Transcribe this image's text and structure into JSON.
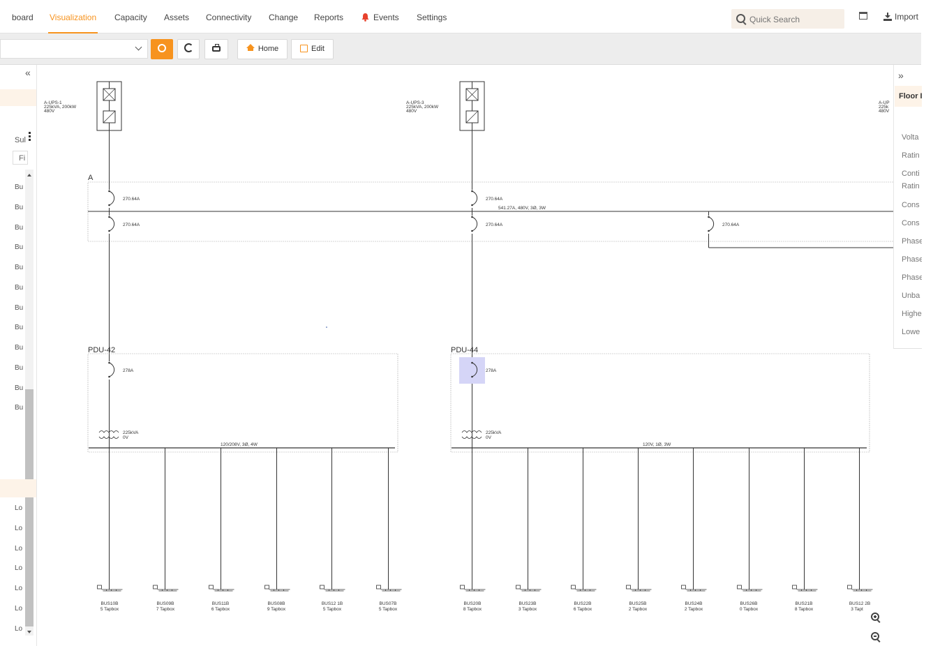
{
  "nav": {
    "items": [
      "board",
      "Visualization",
      "Capacity",
      "Assets",
      "Connectivity",
      "Change",
      "Reports",
      "Events",
      "Settings"
    ],
    "search_placeholder": "Quick Search",
    "import_label": "Import"
  },
  "toolbar": {
    "home_label": "Home",
    "edit_label": "Edit"
  },
  "left_panel": {
    "collapse": "«",
    "filter_label": "Sul",
    "filter_input": "Fi",
    "bus_rows": [
      "Bu",
      "Bu",
      "Bu",
      "Bu",
      "Bu",
      "Bu",
      "Bu",
      "Bu",
      "Bu",
      "Bu",
      "Bu",
      "Bu"
    ],
    "load_rows": [
      "Lo",
      "Lo",
      "Lo",
      "Lo",
      "Lo",
      "Lo",
      "Lo"
    ]
  },
  "right_panel": {
    "expand": "»",
    "title": "Floor I",
    "rows": [
      "Volta",
      "Ratin",
      "Conti",
      "Ratin",
      "Cons",
      "Cons",
      "Phase",
      "Phase",
      "Phase",
      "Unba",
      "Highe",
      "Lowe"
    ]
  },
  "diagram": {
    "ups": [
      {
        "name": "A-UPS-1",
        "rating": "225kVA, 200kW",
        "voltage": "480V"
      },
      {
        "name": "A-UPS-3",
        "rating": "225kVA, 200kW",
        "voltage": "480V"
      },
      {
        "name": "A-UP",
        "rating": "225k",
        "voltage": "480V"
      }
    ],
    "switchboard": {
      "name": "A",
      "bus_label": "541.27A, 480V, 3Ø, 3W",
      "breakers": [
        "270.64A",
        "270.64A",
        "270.64A",
        "270.64A",
        "270.64A"
      ]
    },
    "pdus": [
      {
        "name": "PDU-42",
        "breaker": "278A",
        "transformer": "225kVA",
        "transformer_v": "0V",
        "bus_label": "120/208V, 3Ø, 4W",
        "buses": [
          {
            "name": "BUS10B",
            "tap": "5 Tapbox"
          },
          {
            "name": "BUS09B",
            "tap": "7 Tapbox"
          },
          {
            "name": "BUS11B",
            "tap": "6 Tapbox"
          },
          {
            "name": "BUS08B",
            "tap": "9 Tapbox"
          },
          {
            "name": "BUS12 1B",
            "tap": "5 Tapbox"
          },
          {
            "name": "BUS07B",
            "tap": "5 Tapbox"
          }
        ]
      },
      {
        "name": "PDU-44",
        "breaker": "278A",
        "transformer": "225kVA",
        "transformer_v": "0V",
        "bus_label": "120V, 1Ø, 3W",
        "buses": [
          {
            "name": "BUS20B",
            "tap": "8 Tapbox"
          },
          {
            "name": "BUS23B",
            "tap": "3 Tapbox"
          },
          {
            "name": "BUS22B",
            "tap": "6 Tapbox"
          },
          {
            "name": "BUS25B",
            "tap": "2 Tapbox"
          },
          {
            "name": "BUS24B",
            "tap": "2 Tapbox"
          },
          {
            "name": "BUS26B",
            "tap": "0 Tapbox"
          },
          {
            "name": "BUS21B",
            "tap": "8 Tapbox"
          },
          {
            "name": "BUS12 2B",
            "tap": "3 Tapt"
          }
        ]
      }
    ]
  },
  "colors": {
    "accent": "#f7931e",
    "events_bell": "#e8412c",
    "highlight": "#d5d5f7"
  }
}
